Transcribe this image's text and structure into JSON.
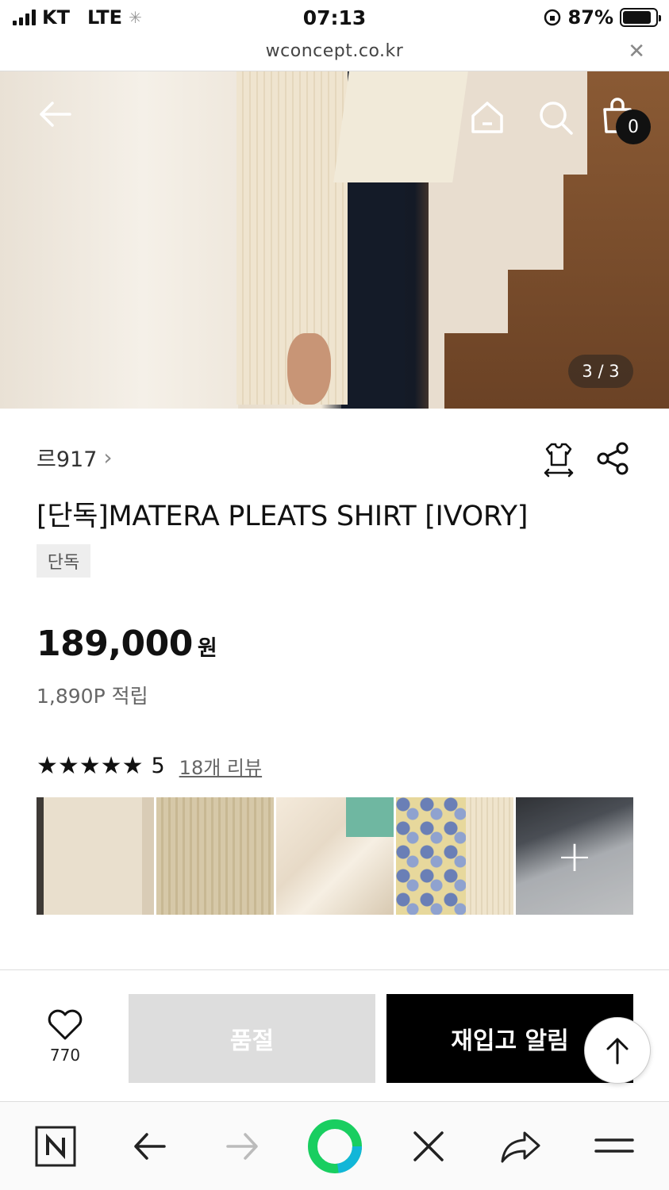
{
  "status_bar": {
    "carrier": "KT",
    "network": "LTE",
    "time": "07:13",
    "battery": "87%",
    "battery_level": 0.87
  },
  "browser": {
    "url": "wconcept.co.kr",
    "close_glyph": "✕"
  },
  "header": {
    "cart_count": "0",
    "image_pager": "3 / 3",
    "icons": [
      "back-arrow-icon",
      "home-icon",
      "search-icon",
      "shopping-bag-icon"
    ]
  },
  "product": {
    "brand": "르917",
    "brand_chevron": "›",
    "title": "[단독]MATERA PLEATS SHIRT [IVORY]",
    "tag": "단독",
    "price": "189,000",
    "price_unit": "원",
    "points": "1,890P 적립",
    "icons": [
      "size-guide-icon",
      "share-icon"
    ]
  },
  "reviews": {
    "stars": "★★★★★",
    "score": "5",
    "count_label": "18개 리뷰",
    "more_glyph": "+"
  },
  "buy_bar": {
    "like_count": "770",
    "soldout_label": "품절",
    "restock_label": "재입고 알림"
  },
  "bottom_bar": {
    "icons": [
      "naver-icon",
      "back-icon",
      "forward-icon",
      "green-circle-icon",
      "close-icon",
      "share-arrow-icon",
      "menu-icon"
    ]
  },
  "colors": {
    "accent_black": "#000000",
    "soldout_gray": "#dddddd",
    "naver_green": "#19ce60"
  }
}
